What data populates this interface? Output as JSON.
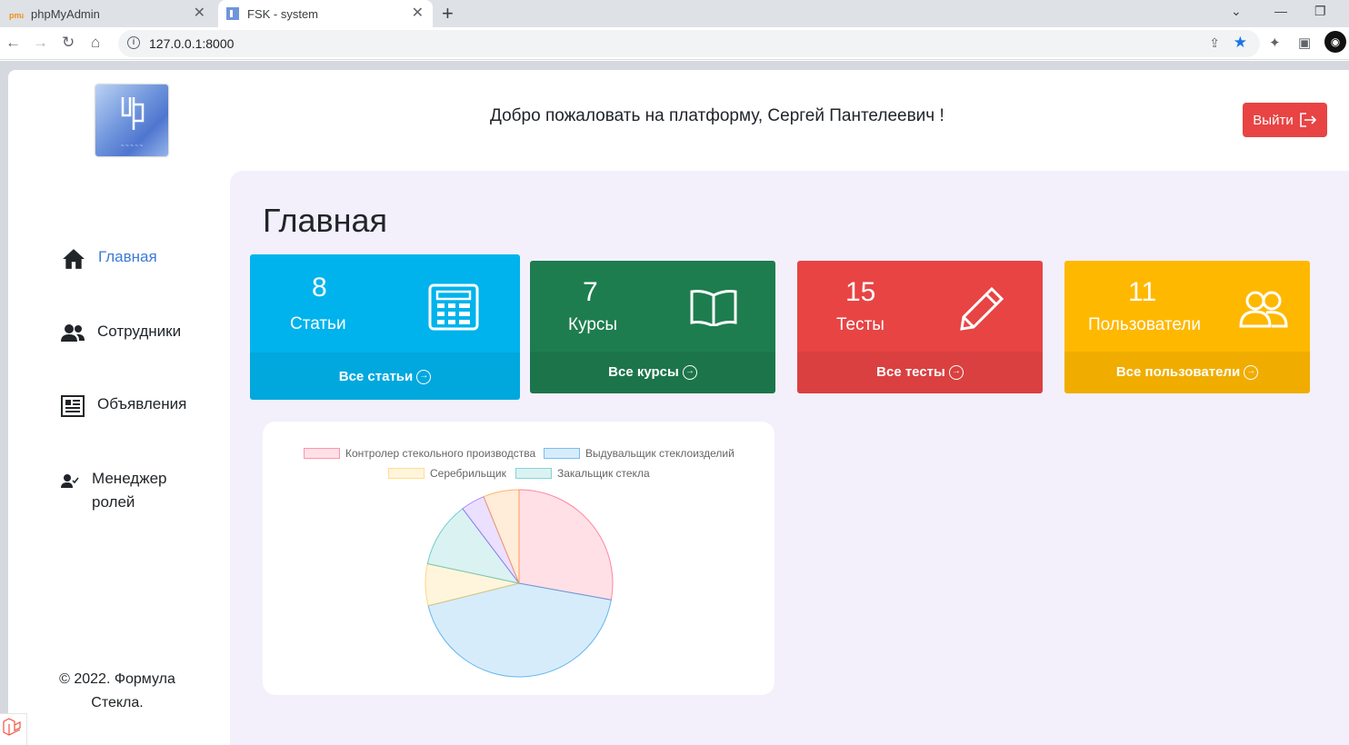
{
  "browser": {
    "tabs": [
      {
        "title": "phpMyAdmin",
        "active": false
      },
      {
        "title": "FSK - system",
        "active": true
      }
    ],
    "url": "127.0.0.1:8000"
  },
  "header": {
    "welcome": "Добро пожаловать на платформу, Сергей Пантелеевич !",
    "logout_label": "Выйти"
  },
  "sidebar": {
    "items": [
      {
        "label": "Главная",
        "icon": "home-icon",
        "active": true
      },
      {
        "label": "Сотрудники",
        "icon": "users-icon",
        "active": false
      },
      {
        "label": "Объявления",
        "icon": "newspaper-icon",
        "active": false
      },
      {
        "label_line1": "Менеджер",
        "label_line2": "ролей",
        "icon": "user-check-icon",
        "active": false
      }
    ],
    "footer_line1": "© 2022. Формула",
    "footer_line2": "Стекла."
  },
  "main": {
    "title": "Главная",
    "cards": [
      {
        "count": "8",
        "label": "Статьи",
        "link": "Все статьи",
        "color": "#00b3ec",
        "icon": "calculator-icon"
      },
      {
        "count": "7",
        "label": "Курсы",
        "link": "Все курсы",
        "color": "#1e7d4f",
        "icon": "book-icon"
      },
      {
        "count": "15",
        "label": "Тесты",
        "link": "Все тесты",
        "color": "#e84444",
        "icon": "pencil-icon"
      },
      {
        "count": "11",
        "label": "Пользователи",
        "link": "Все пользователи",
        "color": "#ffb800",
        "icon": "people-icon"
      }
    ]
  },
  "chart_data": {
    "type": "pie",
    "legend_position": "top",
    "categories": [
      "Контролер стекольного производства",
      "Выдувальщик стеклоизделий",
      "Серебрильщик",
      "Закальщик стекла"
    ],
    "values": [
      27,
      42,
      7,
      11,
      4,
      6
    ],
    "slice_colors": [
      "#ff6384",
      "#36a2eb",
      "#ffcd56",
      "#4bc0c0",
      "#9966ff",
      "#ff9f40"
    ]
  }
}
